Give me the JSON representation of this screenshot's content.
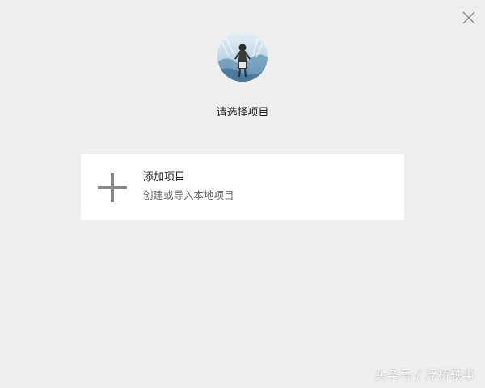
{
  "dialog": {
    "close_icon": "close-icon",
    "avatar_icon": "avatar"
  },
  "main": {
    "title": "请选择项目"
  },
  "card": {
    "icon": "plus-icon",
    "title": "添加项目",
    "subtitle": "创建或导入本地项目"
  },
  "watermark": {
    "text": "头条号 / 浮桥轶事"
  },
  "colors": {
    "background": "#efefef",
    "card": "#ffffff",
    "plus": "#888888",
    "subtitle": "#666666"
  }
}
